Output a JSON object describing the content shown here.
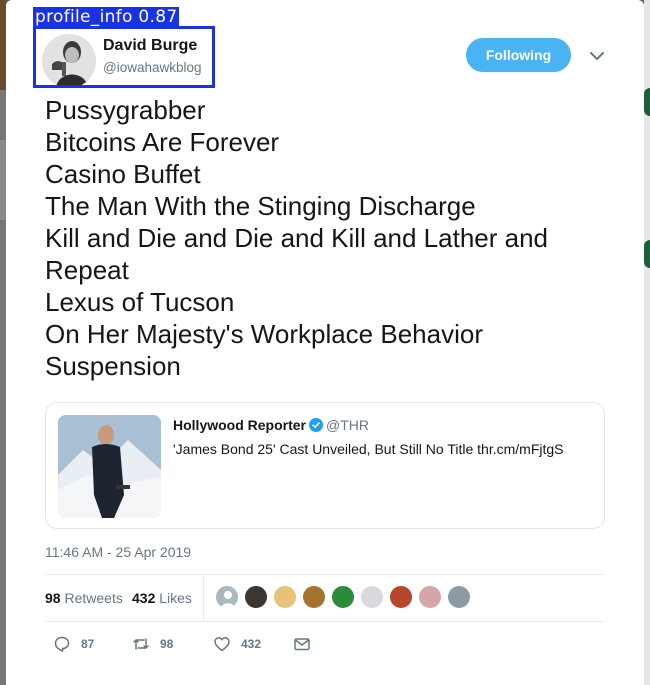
{
  "detection": {
    "label": "profile_info 0.87"
  },
  "author": {
    "name": "David Burge",
    "handle": "@iowahawkblog"
  },
  "follow_button": {
    "label": "Following"
  },
  "tweet": {
    "lines": [
      "Pussygrabber",
      "Bitcoins Are Forever",
      "Casino Buffet",
      "The Man With the Stinging Discharge",
      "Kill and Die and Die and Kill and Lather and",
      "Repeat",
      "Lexus of Tucson",
      "On Her Majesty's Workplace Behavior",
      "Suspension"
    ]
  },
  "quoted": {
    "name": "Hollywood Reporter",
    "handle": "@THR",
    "text": "'James Bond 25' Cast Unveiled, But Still No Title thr.cm/mFjtgS"
  },
  "timestamp": "11:46 AM - 25 Apr 2019",
  "stats": {
    "retweets_count": "98",
    "retweets_label": "Retweets",
    "likes_count": "432",
    "likes_label": "Likes"
  },
  "actions": {
    "reply_count": "87",
    "retweet_count": "98",
    "like_count": "432"
  },
  "colors": {
    "accent": "#4ab3f4",
    "detection_box": "#1932e6",
    "secondary_text": "#657786"
  },
  "icons": [
    "verified-badge-icon",
    "chevron-down-icon",
    "reply-icon",
    "retweet-icon",
    "heart-icon",
    "mail-icon"
  ]
}
